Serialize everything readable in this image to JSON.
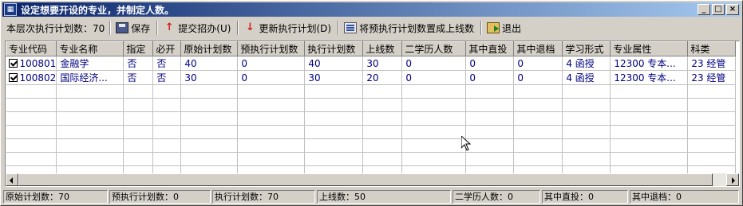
{
  "window": {
    "title": "设定想要开设的专业，并制定人数。"
  },
  "toolbar": {
    "plan_count_label": "本层次执行计划数：70",
    "save_label": "保存",
    "submit_label": "提交招办(U)",
    "update_label": "更新执行计划(D)",
    "set_label": "将预执行计划数置成上线数",
    "exit_label": "退出"
  },
  "table": {
    "headers": [
      "专业代码",
      "专业名称",
      "指定",
      "必开",
      "原始计划数",
      "预执行计划数",
      "执行计划数",
      "上线数",
      "二学历人数",
      "其中直投",
      "其中退档",
      "学习形式",
      "专业属性",
      "科类"
    ],
    "rows": [
      [
        "100801",
        "金融学",
        "否",
        "否",
        "40",
        "0",
        "40",
        "30",
        "0",
        "0",
        "0",
        "4 函授",
        "12300 专本...",
        "23 经管"
      ],
      [
        "100802",
        "国际经济...",
        "否",
        "否",
        "30",
        "0",
        "30",
        "20",
        "0",
        "0",
        "0",
        "4 函授",
        "12300 专本...",
        "23 经管"
      ]
    ]
  },
  "status": {
    "original": "原始计划数：70",
    "pre": "预执行计划数：0",
    "exec": "执行计划数：70",
    "online": "上线数：50",
    "second": "二学历人数：0",
    "direct": "其中直投：0",
    "return": "其中退档：0"
  }
}
